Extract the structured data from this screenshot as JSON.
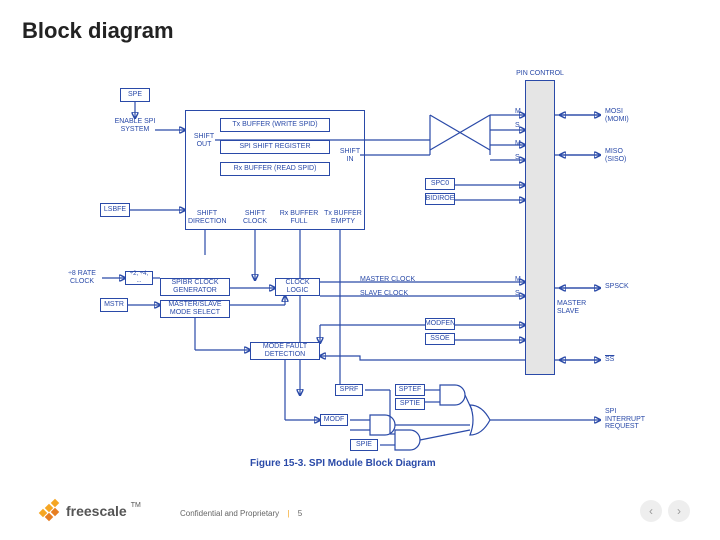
{
  "title": "Block diagram",
  "caption": "Figure 15-3. SPI Module Block Diagram",
  "blocks": {
    "spe": "SPE",
    "enable": "ENABLE\nSPI SYSTEM",
    "lsbfe": "LSBFE",
    "x8rate": "÷2, ÷4, ...",
    "x8label": "÷8 RATE\nCLOCK",
    "mstr": "MSTR",
    "spibr": "SPIBR\nCLOCK GENERATOR",
    "masterslave": "MASTER/SLAVE\nMODE SELECT",
    "txbuf": "Tx BUFFER (WRITE SPID)",
    "shiftreg": "SPI SHIFT REGISTER",
    "rxbuf": "Rx BUFFER (READ SPID)",
    "shiftout": "SHIFT\nOUT",
    "shiftin": "SHIFT\nIN",
    "shiftdir": "SHIFT\nDIRECTION",
    "shiftclk": "SHIFT\nCLOCK",
    "rxfull": "Rx BUFFER\nFULL",
    "txempty": "Tx BUFFER\nEMPTY",
    "clocklogic": "CLOCK\nLOGIC",
    "modefault": "MODE FAULT\nDETECTION",
    "spc0": "SPC0",
    "bidiroe": "BIDIROE",
    "modfen": "MODFEN",
    "ssoe": "SSOE",
    "sprf": "SPRF",
    "sptef": "SPTEF",
    "sptie": "SPTIE",
    "modf": "MODF",
    "spie": "SPIE",
    "masterclk": "MASTER CLOCK",
    "slaveclk": "SLAVE CLOCK",
    "pincontrol": "PIN CONTROL",
    "m1": "M",
    "s1": "S",
    "m2": "M",
    "s2": "S",
    "m3": "M",
    "s3": "S",
    "masterslave2": "MASTER\nSLAVE",
    "mosi": "MOSI\n(MOMI)",
    "miso": "MISO\n(SISO)",
    "spsck": "SPSCK",
    "ss": "SS",
    "spiirq": "SPI\nINTERRUPT\nREQUEST"
  },
  "footer": {
    "brand": "freescale",
    "tm": "TM",
    "conf": "Confidential and Proprietary",
    "page": "5"
  }
}
